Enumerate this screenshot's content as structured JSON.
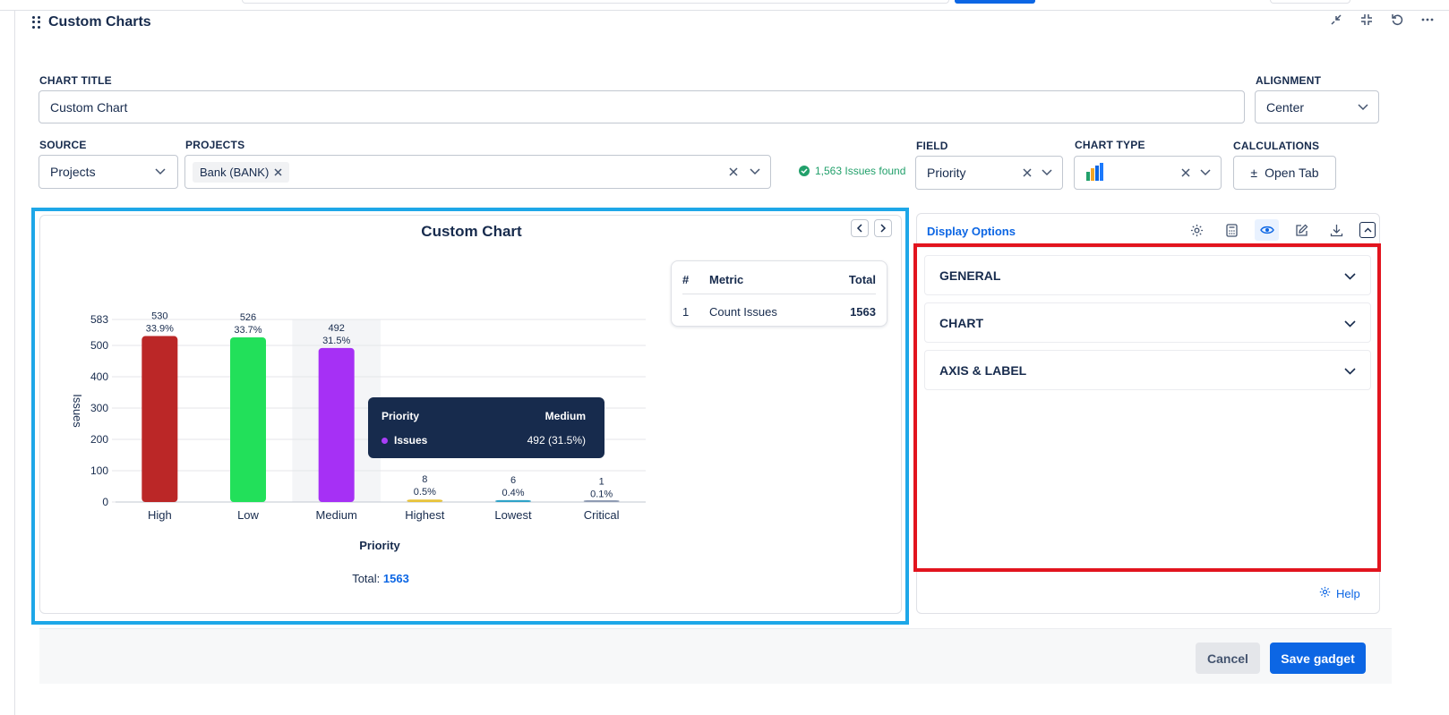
{
  "header": {
    "title": "Custom Charts"
  },
  "form": {
    "chart_title_label": "CHART TITLE",
    "chart_title_value": "Custom Chart",
    "alignment_label": "ALIGNMENT",
    "alignment_value": "Center",
    "source_label": "SOURCE",
    "source_value": "Projects",
    "projects_label": "PROJECTS",
    "project_chip": "Bank (BANK)",
    "issues_found": "1,563 Issues found",
    "field_label": "FIELD",
    "field_value": "Priority",
    "chart_type_label": "CHART TYPE",
    "calculations_label": "CALCULATIONS",
    "open_tab_label": "Open Tab"
  },
  "chart_panel": {
    "metric_table": {
      "headers": [
        "#",
        "Metric",
        "Total"
      ],
      "rows": [
        {
          "num": "1",
          "metric": "Count Issues",
          "total": "1563"
        }
      ]
    },
    "tooltip": {
      "field": "Priority",
      "category": "Medium",
      "series": "Issues",
      "value": "492 (31.5%)"
    },
    "total_label": "Total:",
    "total_value": "1563"
  },
  "chart_data": {
    "type": "bar",
    "title": "Custom Chart",
    "xlabel": "Priority",
    "ylabel": "Issues",
    "categories": [
      "High",
      "Low",
      "Medium",
      "Highest",
      "Lowest",
      "Critical"
    ],
    "values": [
      530,
      526,
      492,
      8,
      6,
      1
    ],
    "percent_labels": [
      "33.9%",
      "33.7%",
      "31.5%",
      "0.5%",
      "0.4%",
      "0.1%"
    ],
    "colors": [
      "#bb2727",
      "#22e05a",
      "#a630f5",
      "#e8c33a",
      "#2fa3c8",
      "#8f9bb3"
    ],
    "yticks": [
      0,
      100,
      200,
      300,
      400,
      500,
      583
    ],
    "ylim": [
      0,
      583
    ],
    "grid": true
  },
  "display_options": {
    "title": "Display Options",
    "sections": [
      "GENERAL",
      "CHART",
      "AXIS & LABEL"
    ],
    "help_label": "Help"
  },
  "footer": {
    "cancel_label": "Cancel",
    "save_label": "Save gadget"
  },
  "colors": {
    "accent": "#0c66e4",
    "highlight_blue": "#1ea7e8",
    "highlight_red": "#e2141e",
    "success": "#22a06b"
  }
}
